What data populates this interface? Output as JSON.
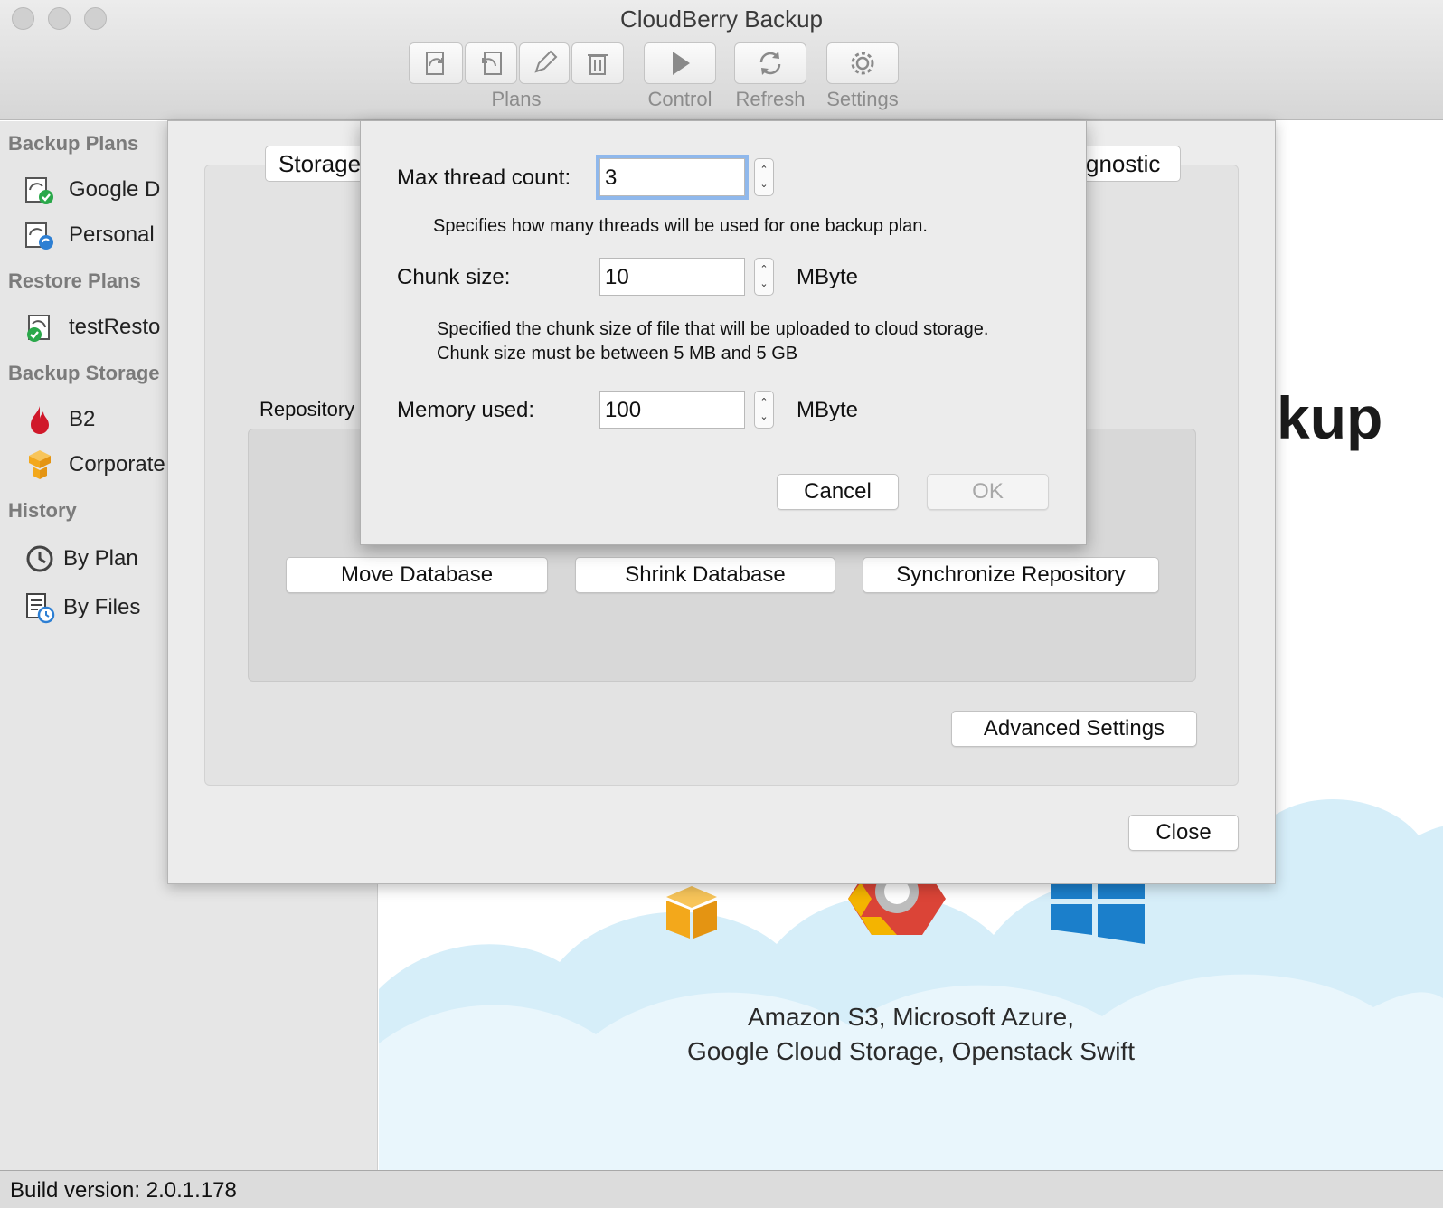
{
  "window": {
    "title": "CloudBerry Backup"
  },
  "toolbar": {
    "groups": [
      {
        "label": "Plans"
      },
      {
        "label": "Control"
      },
      {
        "label": "Refresh"
      },
      {
        "label": "Settings"
      }
    ],
    "icons": [
      "backup-plan-icon",
      "restore-plan-icon",
      "edit-icon",
      "trash-icon",
      "play-icon",
      "refresh-icon",
      "gear-icon"
    ]
  },
  "sidebar": {
    "sections": [
      {
        "title": "Backup Plans",
        "items": [
          {
            "label": "Google D",
            "icon": "backup-plan-success-icon"
          },
          {
            "label": "Personal",
            "icon": "backup-plan-icon"
          }
        ]
      },
      {
        "title": "Restore Plans",
        "items": [
          {
            "label": "testResto",
            "icon": "restore-plan-success-icon"
          }
        ]
      },
      {
        "title": "Backup Storage",
        "items": [
          {
            "label": "B2",
            "icon": "b2-flame-icon"
          },
          {
            "label": "Corporate",
            "icon": "amazon-s3-icon"
          }
        ]
      },
      {
        "title": "History",
        "items": [
          {
            "label": "By Plan",
            "icon": "history-clock-icon"
          },
          {
            "label": "By Files",
            "icon": "file-history-icon"
          }
        ]
      }
    ]
  },
  "main": {
    "big_text": "kup",
    "providers_line1": "Amazon S3, Microsoft Azure,",
    "providers_line2": "Google Cloud Storage, Openstack Swift"
  },
  "options_sheet": {
    "tab_left": "Storage",
    "tab_right": "gnostic",
    "repository_label": "Repository",
    "move_db": "Move Database",
    "shrink_db": "Shrink Database",
    "sync_repo": "Synchronize Repository",
    "advanced": "Advanced Settings",
    "close": "Close"
  },
  "advanced_dialog": {
    "max_thread_label": "Max thread count:",
    "max_thread_value": "3",
    "max_thread_desc": "Specifies how many threads will be used for one backup plan.",
    "chunk_label": "Chunk size:",
    "chunk_value": "10",
    "chunk_unit": "MByte",
    "chunk_desc_1": "Specified the chunk size of file that will be uploaded to cloud storage.",
    "chunk_desc_2": "Chunk size must be between 5 MB and 5 GB",
    "memory_label": "Memory used:",
    "memory_value": "100",
    "memory_unit": "MByte",
    "cancel": "Cancel",
    "ok": "OK"
  },
  "status": {
    "build": "Build version: 2.0.1.178"
  },
  "colors": {
    "aws_orange": "#f3a81b",
    "azure_blue": "#1b7fcb",
    "gcp_red": "#db4437",
    "focus_ring": "#8fb8ec",
    "success_green": "#2aa84a"
  }
}
